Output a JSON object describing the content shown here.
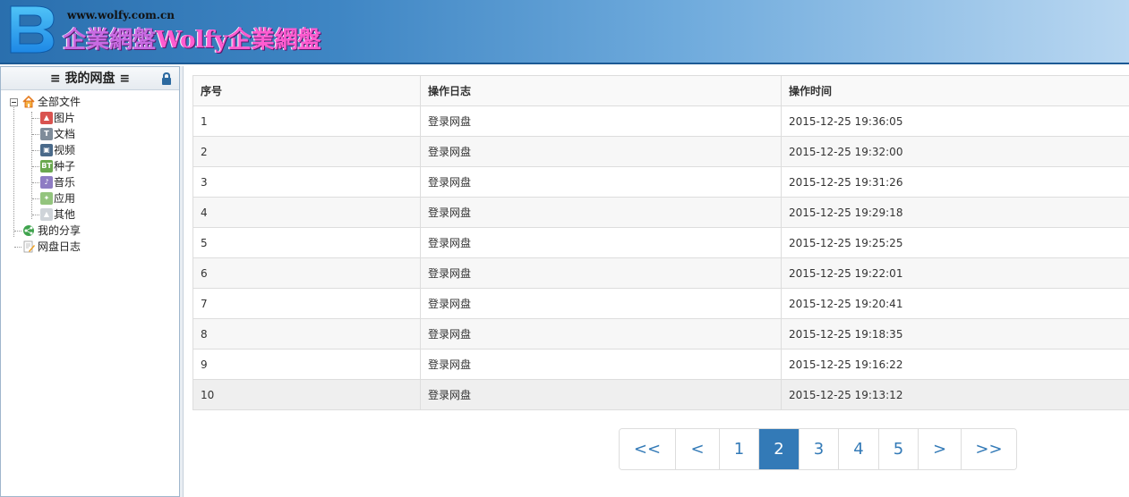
{
  "header": {
    "url_text": "www.wolfy.com.cn",
    "brand_text_1": "企業網盤",
    "brand_text_2": "Wolfy企業網盤",
    "logo_letter": "B"
  },
  "sidebar": {
    "title": "≡ 我的网盘 ≡",
    "tree": [
      {
        "label": "全部文件",
        "icon": "home-icon",
        "level": 0
      },
      {
        "label": "图片",
        "icon": "image-icon",
        "level": 1
      },
      {
        "label": "文档",
        "icon": "document-icon",
        "level": 1
      },
      {
        "label": "视频",
        "icon": "video-icon",
        "level": 1
      },
      {
        "label": "种子",
        "icon": "torrent-icon",
        "level": 1,
        "badge": "BT"
      },
      {
        "label": "音乐",
        "icon": "music-icon",
        "level": 1
      },
      {
        "label": "应用",
        "icon": "app-icon",
        "level": 1
      },
      {
        "label": "其他",
        "icon": "other-icon",
        "level": 1
      },
      {
        "label": "我的分享",
        "icon": "share-icon",
        "level": 0
      },
      {
        "label": "网盘日志",
        "icon": "log-icon",
        "level": 0
      }
    ]
  },
  "table": {
    "headers": [
      "序号",
      "操作日志",
      "操作时间"
    ],
    "rows": [
      [
        "1",
        "登录网盘",
        "2015-12-25 19:36:05"
      ],
      [
        "2",
        "登录网盘",
        "2015-12-25 19:32:00"
      ],
      [
        "3",
        "登录网盘",
        "2015-12-25 19:31:26"
      ],
      [
        "4",
        "登录网盘",
        "2015-12-25 19:29:18"
      ],
      [
        "5",
        "登录网盘",
        "2015-12-25 19:25:25"
      ],
      [
        "6",
        "登录网盘",
        "2015-12-25 19:22:01"
      ],
      [
        "7",
        "登录网盘",
        "2015-12-25 19:20:41"
      ],
      [
        "8",
        "登录网盘",
        "2015-12-25 19:18:35"
      ],
      [
        "9",
        "登录网盘",
        "2015-12-25 19:16:22"
      ],
      [
        "10",
        "登录网盘",
        "2015-12-25 19:13:12"
      ]
    ]
  },
  "pagination": {
    "first": "<<",
    "prev": "<",
    "pages": [
      "1",
      "2",
      "3",
      "4",
      "5"
    ],
    "current": "2",
    "next": ">",
    "last": ">>"
  },
  "colors": {
    "accent": "#337ab7",
    "header_blue": "#2a6fae",
    "brand_pink": "#e94fc5"
  }
}
